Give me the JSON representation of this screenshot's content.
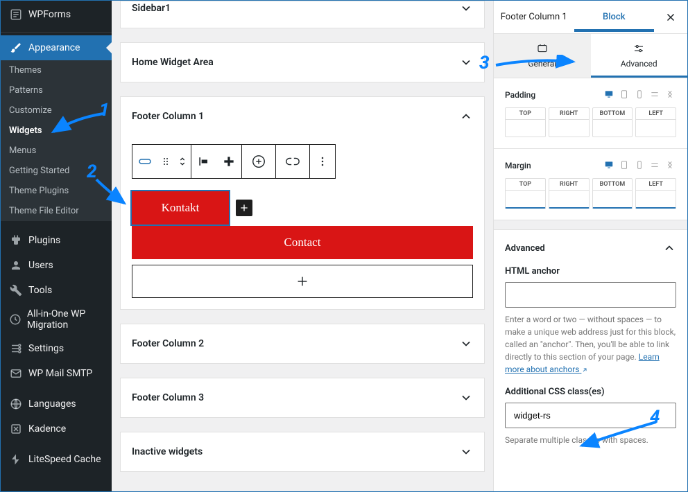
{
  "sidebar": {
    "wpforms": "WPForms",
    "appearance": "Appearance",
    "items": [
      "Themes",
      "Patterns",
      "Customize",
      "Widgets",
      "Menus",
      "Getting Started",
      "Theme Plugins",
      "Theme File Editor"
    ],
    "current_index": 3,
    "lower": [
      "Plugins",
      "Users",
      "Tools",
      "All-in-One WP Migration",
      "Settings",
      "WP Mail SMTP",
      "Languages",
      "Kadence",
      "LiteSpeed Cache"
    ]
  },
  "areas": {
    "sidebar1": "Sidebar1",
    "home": "Home Widget Area",
    "fc1": "Footer Column 1",
    "fc2": "Footer Column 2",
    "fc3": "Footer Column 3",
    "inactive": "Inactive widgets"
  },
  "buttons": {
    "kontakt": "Kontakt",
    "contact": "Contact"
  },
  "panel": {
    "tab_area": "Footer Column 1",
    "tab_block": "Block",
    "subtab_general": "General",
    "subtab_advanced": "Advanced",
    "padding": "Padding",
    "margin": "Margin",
    "box_labels": [
      "TOP",
      "RIGHT",
      "BOTTOM",
      "LEFT"
    ],
    "advanced_section": "Advanced",
    "html_anchor": "HTML anchor",
    "anchor_help_1": "Enter a word or two — without spaces — to make a unique web address just for this block, called an \"anchor\". Then, you'll be able to link directly to this section of your page. ",
    "anchor_link": "Learn more about anchors",
    "css_classes": "Additional CSS class(es)",
    "css_value": "widget-rs",
    "css_help": "Separate multiple classes with spaces."
  },
  "annotations": {
    "n1": "1",
    "n2": "2",
    "n3": "3",
    "n4": "4"
  }
}
